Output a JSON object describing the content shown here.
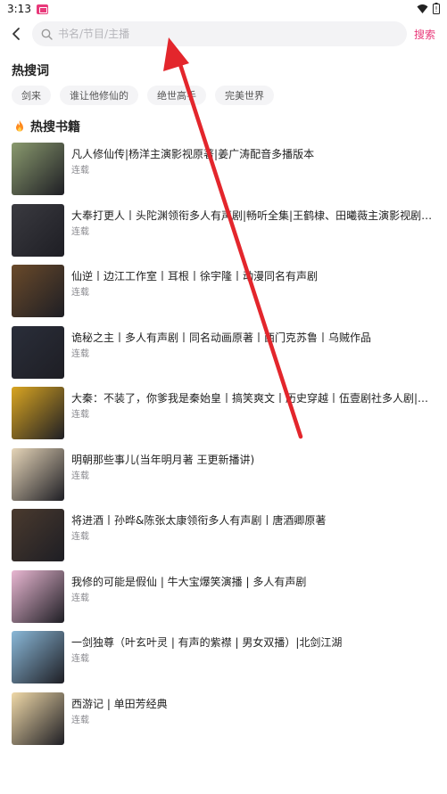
{
  "status_bar": {
    "time": "3:13"
  },
  "search": {
    "placeholder": "书名/节目/主播",
    "button_label": "搜索"
  },
  "hot_words": {
    "title": "热搜词",
    "items": [
      "剑来",
      "谁让他修仙的",
      "绝世高手",
      "完美世界"
    ]
  },
  "hot_books": {
    "title": "热搜书籍",
    "items": [
      {
        "title": "凡人修仙传|杨洋主演影视原著|姜广涛配音多播版本",
        "status": "连载",
        "cover_color": "#8a9a6e"
      },
      {
        "title": "大奉打更人丨头陀渊领衔多人有声剧|畅听全集|王鹤棣、田曦薇主演影视剧原著",
        "status": "连载",
        "cover_color": "#3a3a40"
      },
      {
        "title": "仙逆丨边江工作室丨耳根丨徐宇隆丨动漫同名有声剧",
        "status": "连载",
        "cover_color": "#6a4a2a"
      },
      {
        "title": "诡秘之主丨多人有声剧丨同名动画原著丨西门克苏鲁丨乌贼作品",
        "status": "连载",
        "cover_color": "#2a2e3a"
      },
      {
        "title": "大秦：不装了，你爹我是秦始皇丨搞笑爽文丨历史穿越丨伍壹剧社多人剧|赵...",
        "status": "连载",
        "cover_color": "#d9a521"
      },
      {
        "title": "明朝那些事儿(当年明月著 王更新播讲)",
        "status": "连载",
        "cover_color": "#e6d5b8"
      },
      {
        "title": "将进酒丨孙晔&陈张太康领衔多人有声剧丨唐酒卿原著",
        "status": "连载",
        "cover_color": "#4a3a2e"
      },
      {
        "title": "我修的可能是假仙 | 牛大宝爆笑演播 | 多人有声剧",
        "status": "连载",
        "cover_color": "#e9b7d2"
      },
      {
        "title": "一剑独尊（叶玄叶灵 | 有声的紫襟 | 男女双播）|北剑江湖",
        "status": "连载",
        "cover_color": "#8ab8d8"
      },
      {
        "title": "西游记 | 单田芳经典",
        "status": "连载",
        "cover_color": "#f0d9a8"
      }
    ]
  },
  "colors": {
    "accent": "#e8397a",
    "arrow": "#e3262c"
  }
}
